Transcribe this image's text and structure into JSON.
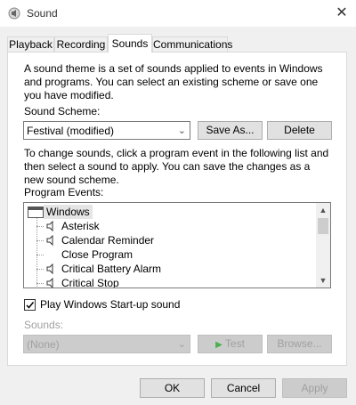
{
  "window": {
    "title": "Sound",
    "close_glyph": "✕"
  },
  "tabs": [
    {
      "label": "Playback"
    },
    {
      "label": "Recording"
    },
    {
      "label": "Sounds"
    },
    {
      "label": "Communications"
    }
  ],
  "sounds_tab": {
    "intro": "A sound theme is a set of sounds applied to events in Windows and programs.  You can select an existing scheme or save one you have modified.",
    "scheme_label": "Sound Scheme:",
    "scheme_value": "Festival (modified)",
    "save_as_label": "Save As...",
    "delete_label": "Delete",
    "change_text": "To change sounds, click a program event in the following list and then select a sound to apply.  You can save the changes as a new sound scheme.",
    "program_events_label": "Program Events:",
    "events": [
      {
        "label": "Windows",
        "is_group": true,
        "has_sound": false
      },
      {
        "label": "Asterisk",
        "is_group": false,
        "has_sound": true
      },
      {
        "label": "Calendar Reminder",
        "is_group": false,
        "has_sound": true
      },
      {
        "label": "Close Program",
        "is_group": false,
        "has_sound": false
      },
      {
        "label": "Critical Battery Alarm",
        "is_group": false,
        "has_sound": true
      },
      {
        "label": "Critical Stop",
        "is_group": false,
        "has_sound": true
      }
    ],
    "startup_checkbox_label": "Play Windows Start-up sound",
    "startup_checked": true,
    "sounds_label": "Sounds:",
    "sounds_value": "(None)",
    "test_label": "Test",
    "browse_label": "Browse..."
  },
  "footer": {
    "ok_label": "OK",
    "cancel_label": "Cancel",
    "apply_label": "Apply"
  }
}
